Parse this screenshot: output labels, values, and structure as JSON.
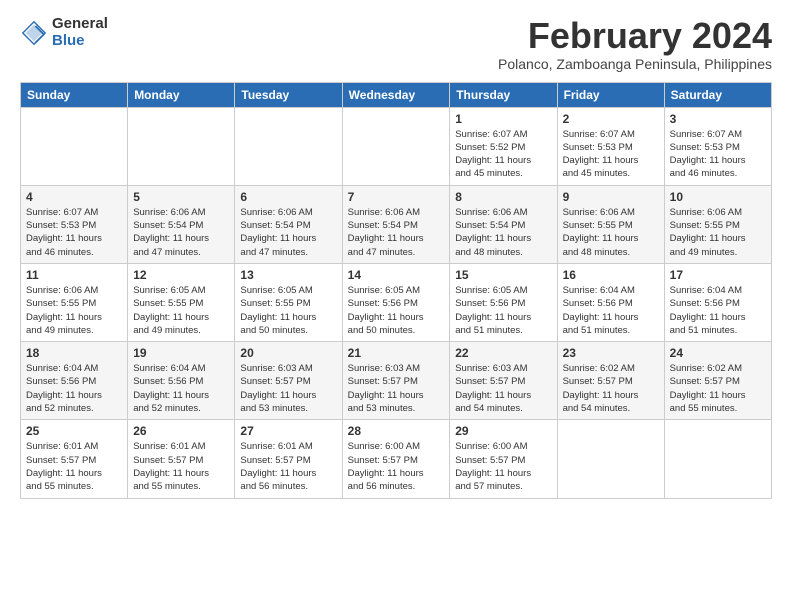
{
  "header": {
    "logo_general": "General",
    "logo_blue": "Blue",
    "month_year": "February 2024",
    "location": "Polanco, Zamboanga Peninsula, Philippines"
  },
  "days_of_week": [
    "Sunday",
    "Monday",
    "Tuesday",
    "Wednesday",
    "Thursday",
    "Friday",
    "Saturday"
  ],
  "weeks": [
    {
      "row": 1,
      "days": [
        {
          "num": "",
          "info": ""
        },
        {
          "num": "",
          "info": ""
        },
        {
          "num": "",
          "info": ""
        },
        {
          "num": "",
          "info": ""
        },
        {
          "num": "1",
          "info": "Sunrise: 6:07 AM\nSunset: 5:52 PM\nDaylight: 11 hours\nand 45 minutes."
        },
        {
          "num": "2",
          "info": "Sunrise: 6:07 AM\nSunset: 5:53 PM\nDaylight: 11 hours\nand 45 minutes."
        },
        {
          "num": "3",
          "info": "Sunrise: 6:07 AM\nSunset: 5:53 PM\nDaylight: 11 hours\nand 46 minutes."
        }
      ]
    },
    {
      "row": 2,
      "days": [
        {
          "num": "4",
          "info": "Sunrise: 6:07 AM\nSunset: 5:53 PM\nDaylight: 11 hours\nand 46 minutes."
        },
        {
          "num": "5",
          "info": "Sunrise: 6:06 AM\nSunset: 5:54 PM\nDaylight: 11 hours\nand 47 minutes."
        },
        {
          "num": "6",
          "info": "Sunrise: 6:06 AM\nSunset: 5:54 PM\nDaylight: 11 hours\nand 47 minutes."
        },
        {
          "num": "7",
          "info": "Sunrise: 6:06 AM\nSunset: 5:54 PM\nDaylight: 11 hours\nand 47 minutes."
        },
        {
          "num": "8",
          "info": "Sunrise: 6:06 AM\nSunset: 5:54 PM\nDaylight: 11 hours\nand 48 minutes."
        },
        {
          "num": "9",
          "info": "Sunrise: 6:06 AM\nSunset: 5:55 PM\nDaylight: 11 hours\nand 48 minutes."
        },
        {
          "num": "10",
          "info": "Sunrise: 6:06 AM\nSunset: 5:55 PM\nDaylight: 11 hours\nand 49 minutes."
        }
      ]
    },
    {
      "row": 3,
      "days": [
        {
          "num": "11",
          "info": "Sunrise: 6:06 AM\nSunset: 5:55 PM\nDaylight: 11 hours\nand 49 minutes."
        },
        {
          "num": "12",
          "info": "Sunrise: 6:05 AM\nSunset: 5:55 PM\nDaylight: 11 hours\nand 49 minutes."
        },
        {
          "num": "13",
          "info": "Sunrise: 6:05 AM\nSunset: 5:55 PM\nDaylight: 11 hours\nand 50 minutes."
        },
        {
          "num": "14",
          "info": "Sunrise: 6:05 AM\nSunset: 5:56 PM\nDaylight: 11 hours\nand 50 minutes."
        },
        {
          "num": "15",
          "info": "Sunrise: 6:05 AM\nSunset: 5:56 PM\nDaylight: 11 hours\nand 51 minutes."
        },
        {
          "num": "16",
          "info": "Sunrise: 6:04 AM\nSunset: 5:56 PM\nDaylight: 11 hours\nand 51 minutes."
        },
        {
          "num": "17",
          "info": "Sunrise: 6:04 AM\nSunset: 5:56 PM\nDaylight: 11 hours\nand 51 minutes."
        }
      ]
    },
    {
      "row": 4,
      "days": [
        {
          "num": "18",
          "info": "Sunrise: 6:04 AM\nSunset: 5:56 PM\nDaylight: 11 hours\nand 52 minutes."
        },
        {
          "num": "19",
          "info": "Sunrise: 6:04 AM\nSunset: 5:56 PM\nDaylight: 11 hours\nand 52 minutes."
        },
        {
          "num": "20",
          "info": "Sunrise: 6:03 AM\nSunset: 5:57 PM\nDaylight: 11 hours\nand 53 minutes."
        },
        {
          "num": "21",
          "info": "Sunrise: 6:03 AM\nSunset: 5:57 PM\nDaylight: 11 hours\nand 53 minutes."
        },
        {
          "num": "22",
          "info": "Sunrise: 6:03 AM\nSunset: 5:57 PM\nDaylight: 11 hours\nand 54 minutes."
        },
        {
          "num": "23",
          "info": "Sunrise: 6:02 AM\nSunset: 5:57 PM\nDaylight: 11 hours\nand 54 minutes."
        },
        {
          "num": "24",
          "info": "Sunrise: 6:02 AM\nSunset: 5:57 PM\nDaylight: 11 hours\nand 55 minutes."
        }
      ]
    },
    {
      "row": 5,
      "days": [
        {
          "num": "25",
          "info": "Sunrise: 6:01 AM\nSunset: 5:57 PM\nDaylight: 11 hours\nand 55 minutes."
        },
        {
          "num": "26",
          "info": "Sunrise: 6:01 AM\nSunset: 5:57 PM\nDaylight: 11 hours\nand 55 minutes."
        },
        {
          "num": "27",
          "info": "Sunrise: 6:01 AM\nSunset: 5:57 PM\nDaylight: 11 hours\nand 56 minutes."
        },
        {
          "num": "28",
          "info": "Sunrise: 6:00 AM\nSunset: 5:57 PM\nDaylight: 11 hours\nand 56 minutes."
        },
        {
          "num": "29",
          "info": "Sunrise: 6:00 AM\nSunset: 5:57 PM\nDaylight: 11 hours\nand 57 minutes."
        },
        {
          "num": "",
          "info": ""
        },
        {
          "num": "",
          "info": ""
        }
      ]
    }
  ]
}
